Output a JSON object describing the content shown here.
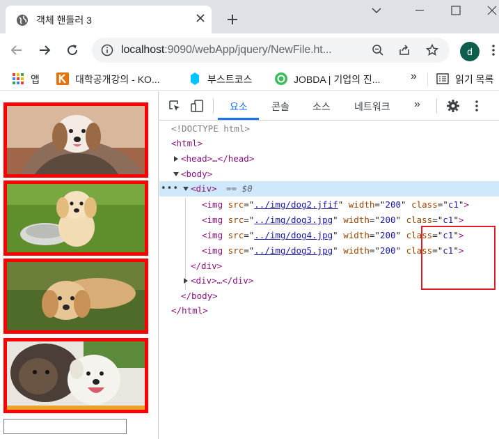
{
  "browser": {
    "tab_title": "객체 핸들러 3",
    "url_host": "localhost",
    "url_rest": ":9090/webApp/jquery/NewFile.ht...",
    "avatar_letter": "d"
  },
  "bookmarks": [
    {
      "label": "앱",
      "icon": "apps-grid-icon"
    },
    {
      "label": "대학공개강의 - KO...",
      "icon": "kocw-icon"
    },
    {
      "label": "부스트코스",
      "icon": "boostcourse-icon"
    },
    {
      "label": "JOBDA | 기업의 진...",
      "icon": "jobda-icon"
    },
    {
      "label": "»",
      "icon": ""
    },
    {
      "label": "읽기 목록",
      "icon": "reading-list-icon"
    }
  ],
  "page": {
    "images": [
      {
        "alt": "dog2",
        "description_icon": "puppy-blanket-image"
      },
      {
        "alt": "dog3",
        "description_icon": "puppy-bowl-image"
      },
      {
        "alt": "dog4",
        "description_icon": "puppy-grass-image"
      },
      {
        "alt": "dog5",
        "description_icon": "puppies-pair-image"
      }
    ],
    "input_value": ""
  },
  "devtools": {
    "tabs": [
      "요소",
      "콘솔",
      "소스",
      "네트워크"
    ],
    "active_tab": "요소",
    "more_tabs": "»",
    "dom": {
      "doctype": "<!DOCTYPE html>",
      "html_open": "<html>",
      "head_collapsed": "<head>…</head>",
      "body_open": "<body>",
      "div_open": "<div>",
      "div_marker": "== $0",
      "img_lines": [
        {
          "src": "../img/dog2.jfif",
          "width": "200",
          "class": "c1"
        },
        {
          "src": "../img/dog3.jpg",
          "width": "200",
          "class": "c1"
        },
        {
          "src": "../img/dog4.jpg",
          "width": "200",
          "class": "c1"
        },
        {
          "src": "../img/dog5.jpg",
          "width": "200",
          "class": "c1"
        }
      ],
      "div_close": "</div>",
      "div2_collapsed": "<div>…</div>",
      "body_close": "</body>",
      "html_close": "</html>"
    }
  },
  "colors": {
    "image_border": "#ff0000",
    "highlight_box": "#e01b24",
    "active_tab": "#1a73e8",
    "selected_row": "#cfe8fc"
  }
}
